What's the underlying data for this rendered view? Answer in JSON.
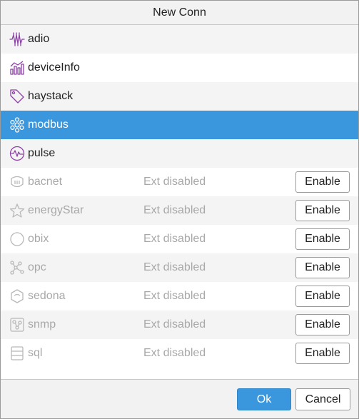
{
  "dialog": {
    "title": "New Conn",
    "ok_label": "Ok",
    "cancel_label": "Cancel"
  },
  "colors": {
    "accent": "#3a96dd",
    "icon_enabled": "#8e3fa8",
    "icon_selected": "#ffffff",
    "icon_disabled": "#b8b8b8"
  },
  "connectors": [
    {
      "name": "adio",
      "icon": "adio-icon",
      "enabled": true,
      "selected": false
    },
    {
      "name": "deviceInfo",
      "icon": "device-info-icon",
      "enabled": true,
      "selected": false
    },
    {
      "name": "haystack",
      "icon": "tag-icon",
      "enabled": true,
      "selected": false
    },
    {
      "name": "modbus",
      "icon": "modbus-icon",
      "enabled": true,
      "selected": true
    },
    {
      "name": "pulse",
      "icon": "pulse-icon",
      "enabled": true,
      "selected": false
    },
    {
      "name": "bacnet",
      "icon": "bacnet-icon",
      "enabled": false,
      "status": "Ext disabled",
      "action": "Enable"
    },
    {
      "name": "energyStar",
      "icon": "star-icon",
      "enabled": false,
      "status": "Ext disabled",
      "action": "Enable"
    },
    {
      "name": "obix",
      "icon": "obix-icon",
      "enabled": false,
      "status": "Ext disabled",
      "action": "Enable"
    },
    {
      "name": "opc",
      "icon": "opc-icon",
      "enabled": false,
      "status": "Ext disabled",
      "action": "Enable"
    },
    {
      "name": "sedona",
      "icon": "sedona-icon",
      "enabled": false,
      "status": "Ext disabled",
      "action": "Enable"
    },
    {
      "name": "snmp",
      "icon": "snmp-icon",
      "enabled": false,
      "status": "Ext disabled",
      "action": "Enable"
    },
    {
      "name": "sql",
      "icon": "database-icon",
      "enabled": false,
      "status": "Ext disabled",
      "action": "Enable"
    }
  ]
}
